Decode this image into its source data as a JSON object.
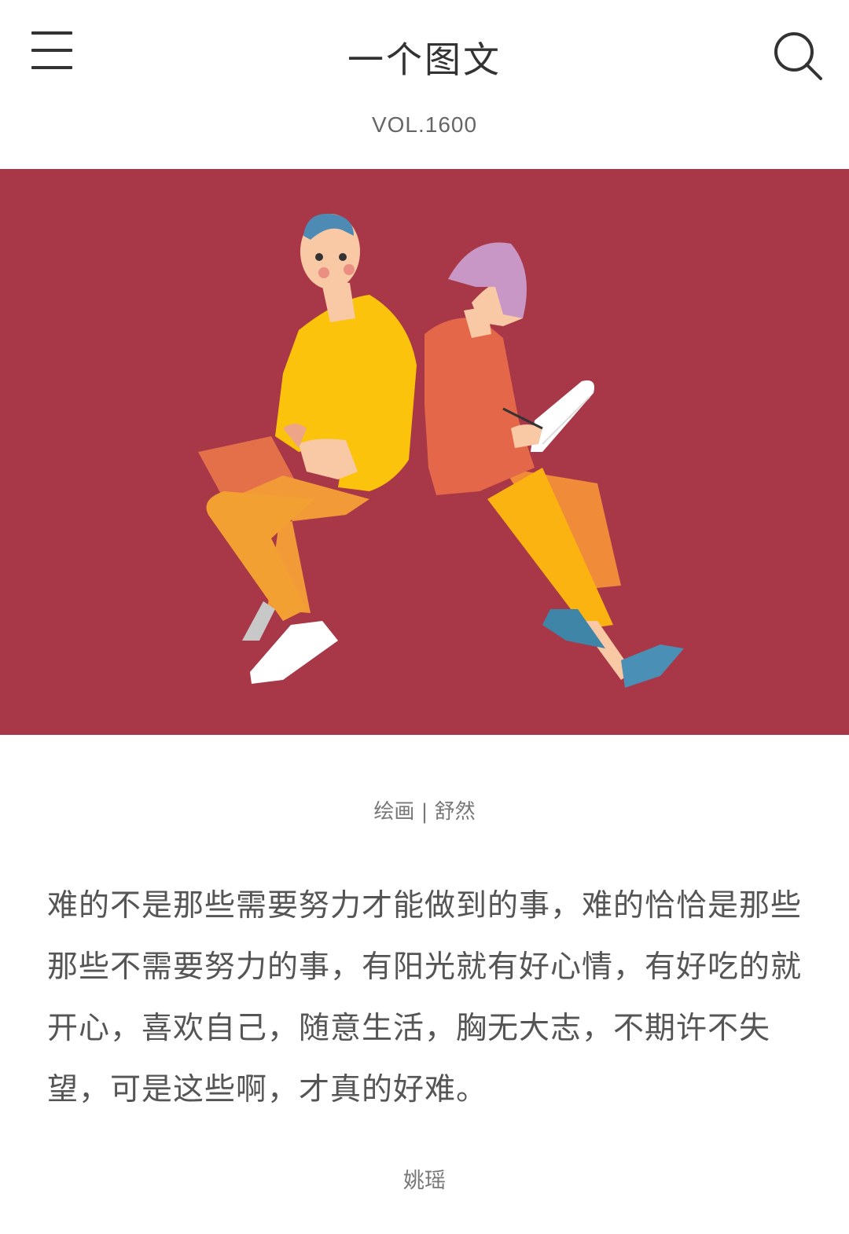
{
  "header": {
    "title": "一个图文",
    "volume": "VOL.1600"
  },
  "icons": {
    "menu": "menu-icon",
    "search": "search-icon"
  },
  "colors": {
    "hero_background": "#a83848",
    "text_primary": "#333333",
    "text_secondary": "#777777"
  },
  "image": {
    "credit": "绘画 | 舒然"
  },
  "article": {
    "quote": "难的不是那些需要努力才能做到的事，难的恰恰是那些那些不需要努力的事，有阳光就有好心情，有好吃的就开心，喜欢自己，随意生活，胸无大志，不期许不失望，可是这些啊，才真的好难。",
    "author": "姚瑶"
  }
}
